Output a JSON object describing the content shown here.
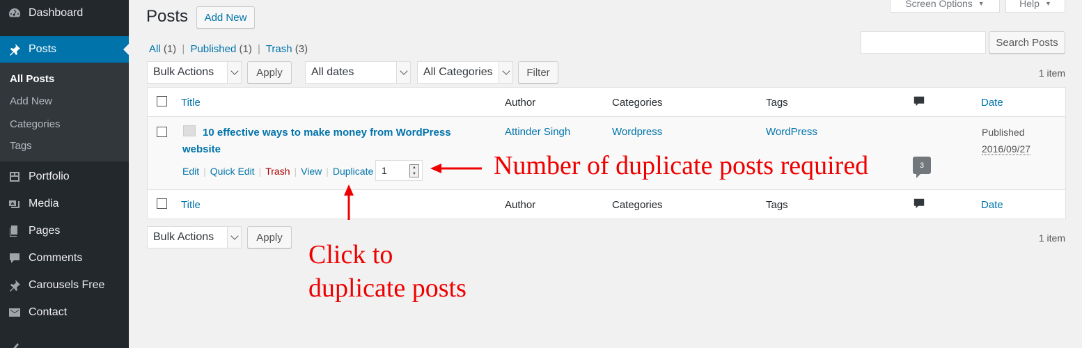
{
  "sidebar": {
    "items": [
      {
        "label": "Dashboard",
        "icon": "dashboard-icon"
      },
      {
        "label": "Posts",
        "icon": "pushpin-icon"
      },
      {
        "label": "Portfolio",
        "icon": "portfolio-icon"
      },
      {
        "label": "Media",
        "icon": "media-icon"
      },
      {
        "label": "Pages",
        "icon": "pages-icon"
      },
      {
        "label": "Comments",
        "icon": "comment-icon"
      },
      {
        "label": "Carousels Free",
        "icon": "pushpin-icon"
      },
      {
        "label": "Contact",
        "icon": "mail-icon"
      }
    ],
    "submenu": [
      "All Posts",
      "Add New",
      "Categories",
      "Tags"
    ]
  },
  "header": {
    "screen_options": "Screen Options",
    "help": "Help",
    "title": "Posts",
    "add_new": "Add New"
  },
  "filters": {
    "all": "All",
    "all_count": "(1)",
    "published": "Published",
    "published_count": "(1)",
    "trash": "Trash",
    "trash_count": "(3)"
  },
  "search": {
    "value": "",
    "button": "Search Posts"
  },
  "tablenav": {
    "bulk_actions": "Bulk Actions",
    "apply": "Apply",
    "dates": "All dates",
    "categories": "All Categories",
    "filter": "Filter",
    "item_count": "1 item"
  },
  "table": {
    "columns": {
      "title": "Title",
      "author": "Author",
      "categories": "Categories",
      "tags": "Tags",
      "date": "Date"
    },
    "rows": [
      {
        "title": "10 effective ways to make money from WordPress website",
        "author": "Attinder Singh",
        "categories": "Wordpress",
        "tags": "WordPress",
        "comments": "3",
        "status": "Published",
        "date": "2016/09/27"
      }
    ],
    "row_actions": {
      "edit": "Edit",
      "quick_edit": "Quick Edit",
      "trash": "Trash",
      "view": "View",
      "duplicate": "Duplicate",
      "duplicate_count": "1"
    }
  },
  "annotations": {
    "number_label": "Number of duplicate posts required",
    "click_label_line1": "Click to",
    "click_label_line2": "duplicate posts",
    "color": "#e00000"
  },
  "colors": {
    "sidebar_bg": "#23282d",
    "active_bg": "#0073aa",
    "link": "#0073aa",
    "trash": "#aa0000"
  }
}
